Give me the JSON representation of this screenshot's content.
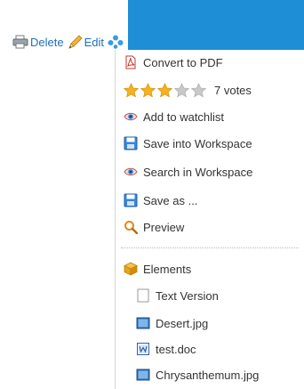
{
  "toolbar": {
    "delete_label": "Delete",
    "edit_label": "Edit",
    "delete_icon": "printer-icon",
    "edit_icon": "pencil-icon",
    "more_icon": "blue-dots-icon"
  },
  "menu": {
    "convert_pdf": "Convert to PDF",
    "rating": {
      "filled": 3,
      "total": 5,
      "votes_label": "7 votes"
    },
    "add_watchlist": "Add to watchlist",
    "save_workspace": "Save into Workspace",
    "search_workspace": "Search in Workspace",
    "save_as": "Save as ...",
    "preview": "Preview",
    "elements": "Elements",
    "children": [
      {
        "label": "Text Version",
        "icon": "blank-document-icon"
      },
      {
        "label": "Desert.jpg",
        "icon": "image-icon"
      },
      {
        "label": "test.doc",
        "icon": "word-document-icon"
      },
      {
        "label": "Chrysanthemum.jpg",
        "icon": "image-icon"
      }
    ]
  },
  "colors": {
    "link": "#1f6fb8",
    "band": "#1e8fd6",
    "star_filled": "#f6b21a",
    "star_empty": "#c8c8c8"
  }
}
